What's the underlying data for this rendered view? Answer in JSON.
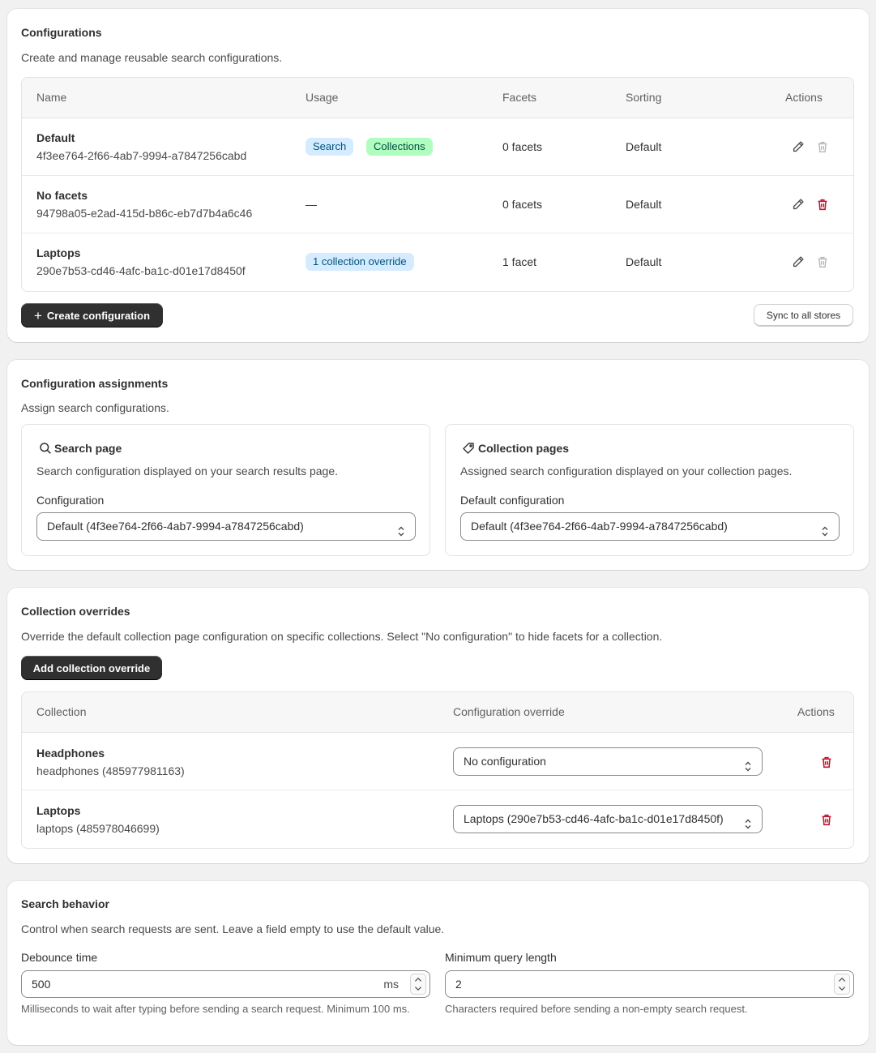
{
  "configurations": {
    "title": "Configurations",
    "subtitle": "Create and manage reusable search configurations.",
    "columns": [
      "Name",
      "Usage",
      "Facets",
      "Sorting",
      "Actions"
    ],
    "rows": [
      {
        "name": "Default",
        "id": "4f3ee764-2f66-4ab7-9994-a7847256cabd",
        "usage": [
          "Search",
          "Collections"
        ],
        "facets": "0 facets",
        "sorting": "Default",
        "delete_enabled": false
      },
      {
        "name": "No facets",
        "id": "94798a05-e2ad-415d-b86c-eb7d7b4a6c46",
        "usage_text": "—",
        "facets": "0 facets",
        "sorting": "Default",
        "delete_enabled": true
      },
      {
        "name": "Laptops",
        "id": "290e7b53-cd46-4afc-ba1c-d01e17d8450f",
        "usage": [
          "1 collection override"
        ],
        "facets": "1 facet",
        "sorting": "Default",
        "delete_enabled": false
      }
    ],
    "create_label": "Create configuration",
    "sync_label": "Sync to all stores"
  },
  "assignments": {
    "title": "Configuration assignments",
    "subtitle": "Assign search configurations.",
    "search_page": {
      "title": "Search page",
      "description": "Search configuration displayed on your search results page.",
      "field_label": "Configuration",
      "value": "Default (4f3ee764-2f66-4ab7-9994-a7847256cabd)"
    },
    "collection_pages": {
      "title": "Collection pages",
      "description": "Assigned search configuration displayed on your collection pages.",
      "field_label": "Default configuration",
      "value": "Default (4f3ee764-2f66-4ab7-9994-a7847256cabd)"
    }
  },
  "overrides": {
    "title": "Collection overrides",
    "subtitle": "Override the default collection page configuration on specific collections. Select \"No configuration\" to hide facets for a collection.",
    "add_label": "Add collection override",
    "columns": [
      "Collection",
      "Configuration override",
      "Actions"
    ],
    "rows": [
      {
        "name": "Headphones",
        "handle": "headphones (485977981163)",
        "value": "No configuration"
      },
      {
        "name": "Laptops",
        "handle": "laptops (485978046699)",
        "value": "Laptops (290e7b53-cd46-4afc-ba1c-d01e17d8450f)"
      }
    ]
  },
  "behavior": {
    "title": "Search behavior",
    "subtitle": "Control when search requests are sent. Leave a field empty to use the default value.",
    "debounce": {
      "label": "Debounce time",
      "value": "500",
      "suffix": "ms",
      "help": "Milliseconds to wait after typing before sending a search request. Minimum 100 ms."
    },
    "min_query": {
      "label": "Minimum query length",
      "value": "2",
      "help": "Characters required before sending a non-empty search request."
    }
  },
  "colors": {
    "danger": "#c5102e",
    "muted_icon": "#b5b5b5",
    "primary_button": "#303030"
  }
}
